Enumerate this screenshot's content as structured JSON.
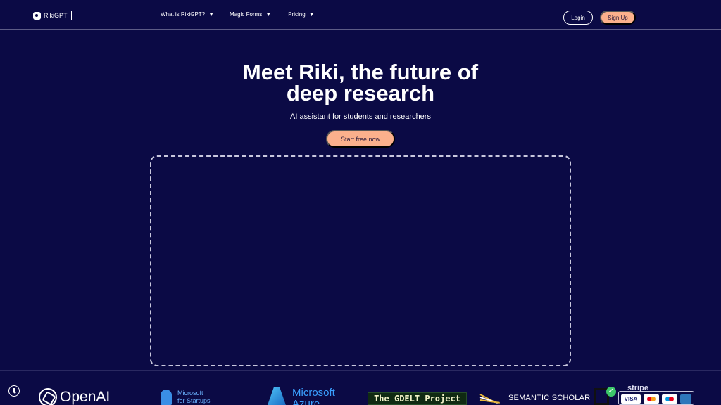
{
  "header": {
    "brand": "RikiGPT",
    "nav": [
      {
        "label": "What is RikiGPT?"
      },
      {
        "label": "Magic Forms"
      },
      {
        "label": "Pricing"
      }
    ],
    "login_label": "Login",
    "signup_label": "Sign Up"
  },
  "hero": {
    "title_line1": "Meet Riki, the future of",
    "title_line2": "deep research",
    "subtitle": "AI assistant for students and researchers",
    "cta_label": "Start free now"
  },
  "partners": {
    "openai": "OpenAI",
    "ms_startups_line1": "Microsoft",
    "ms_startups_line2": "for Startups",
    "azure_line1": "Microsoft",
    "azure_line2": "Azure",
    "gdelt": "The GDELT Project",
    "semantic": "SEMANTIC SCHOLAR",
    "stripe": "stripe",
    "visa": "VISA"
  },
  "colors": {
    "background": "#0b0a45",
    "accent": "#fbb08c",
    "text": "#ffffff"
  },
  "icons": {
    "clock": "clock-icon",
    "caret": "caret-down-icon"
  }
}
